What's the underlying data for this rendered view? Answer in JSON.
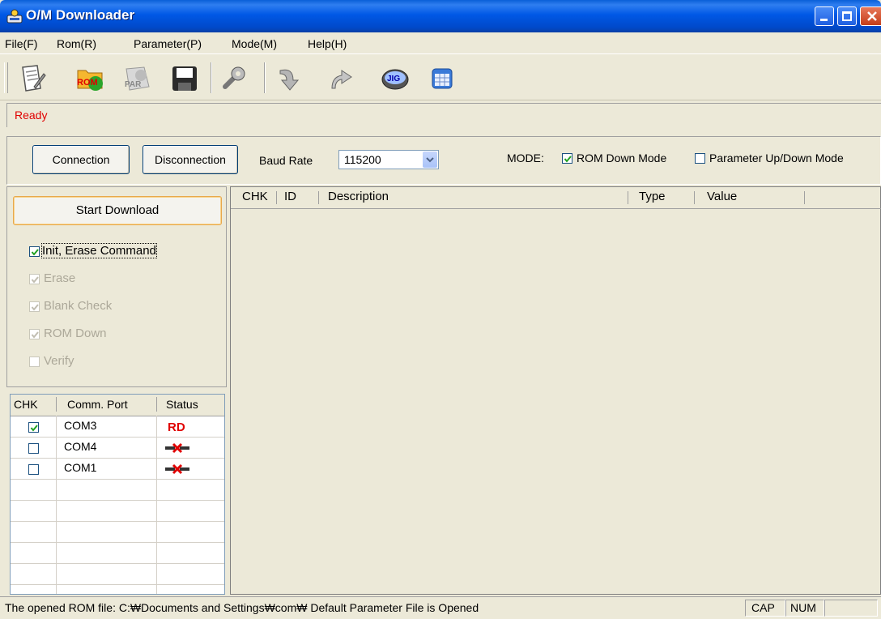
{
  "window": {
    "title": "O/M Downloader"
  },
  "menu": [
    "File(F)",
    "Rom(R)",
    "Parameter(P)",
    "Mode(M)",
    "Help(H)"
  ],
  "toolbar": {
    "icons": [
      "document-edit-icon",
      "open-rom-icon",
      "open-par-icon",
      "save-disk-icon",
      "settings-wrench-icon",
      "download-arrow-icon",
      "upload-arrow-icon",
      "jig-chip-icon",
      "calendar-window-icon"
    ],
    "rom_label": "ROM",
    "par_label": "PAR",
    "jig_label": "JIG"
  },
  "status": {
    "text": "Ready",
    "color": "#e00000"
  },
  "connection": {
    "connect_label": "Connection",
    "disconnect_label": "Disconnection",
    "baud_label": "Baud Rate",
    "baud_value": "115200",
    "mode_label": "MODE:",
    "rom_mode_label": "ROM Down Mode",
    "rom_mode_checked": true,
    "param_mode_label": "Parameter Up/Down Mode",
    "param_mode_checked": false
  },
  "download": {
    "start_label": "Start Download",
    "options": [
      {
        "label": "Init, Erase Command",
        "checked": true,
        "enabled": true
      },
      {
        "label": "Erase",
        "checked": true,
        "enabled": false
      },
      {
        "label": "Blank Check",
        "checked": true,
        "enabled": false
      },
      {
        "label": "ROM Down",
        "checked": true,
        "enabled": false
      },
      {
        "label": "Verify",
        "checked": false,
        "enabled": false
      }
    ]
  },
  "ports": {
    "headers": [
      "CHK",
      "Comm. Port",
      "Status"
    ],
    "rows": [
      {
        "checked": true,
        "port": "COM3",
        "status": "RD"
      },
      {
        "checked": false,
        "port": "COM4",
        "status": "disconnected-plug-icon"
      },
      {
        "checked": false,
        "port": "COM1",
        "status": "disconnected-plug-icon"
      }
    ],
    "status_color": "#e00000"
  },
  "list": {
    "headers": [
      "CHK",
      "ID",
      "Description",
      "Type",
      "Value"
    ]
  },
  "statusbar": {
    "message": "The opened ROM file: C:₩Documents and Settings₩com₩ Default Parameter File is Opened",
    "caps": "CAP",
    "num": "NUM"
  }
}
